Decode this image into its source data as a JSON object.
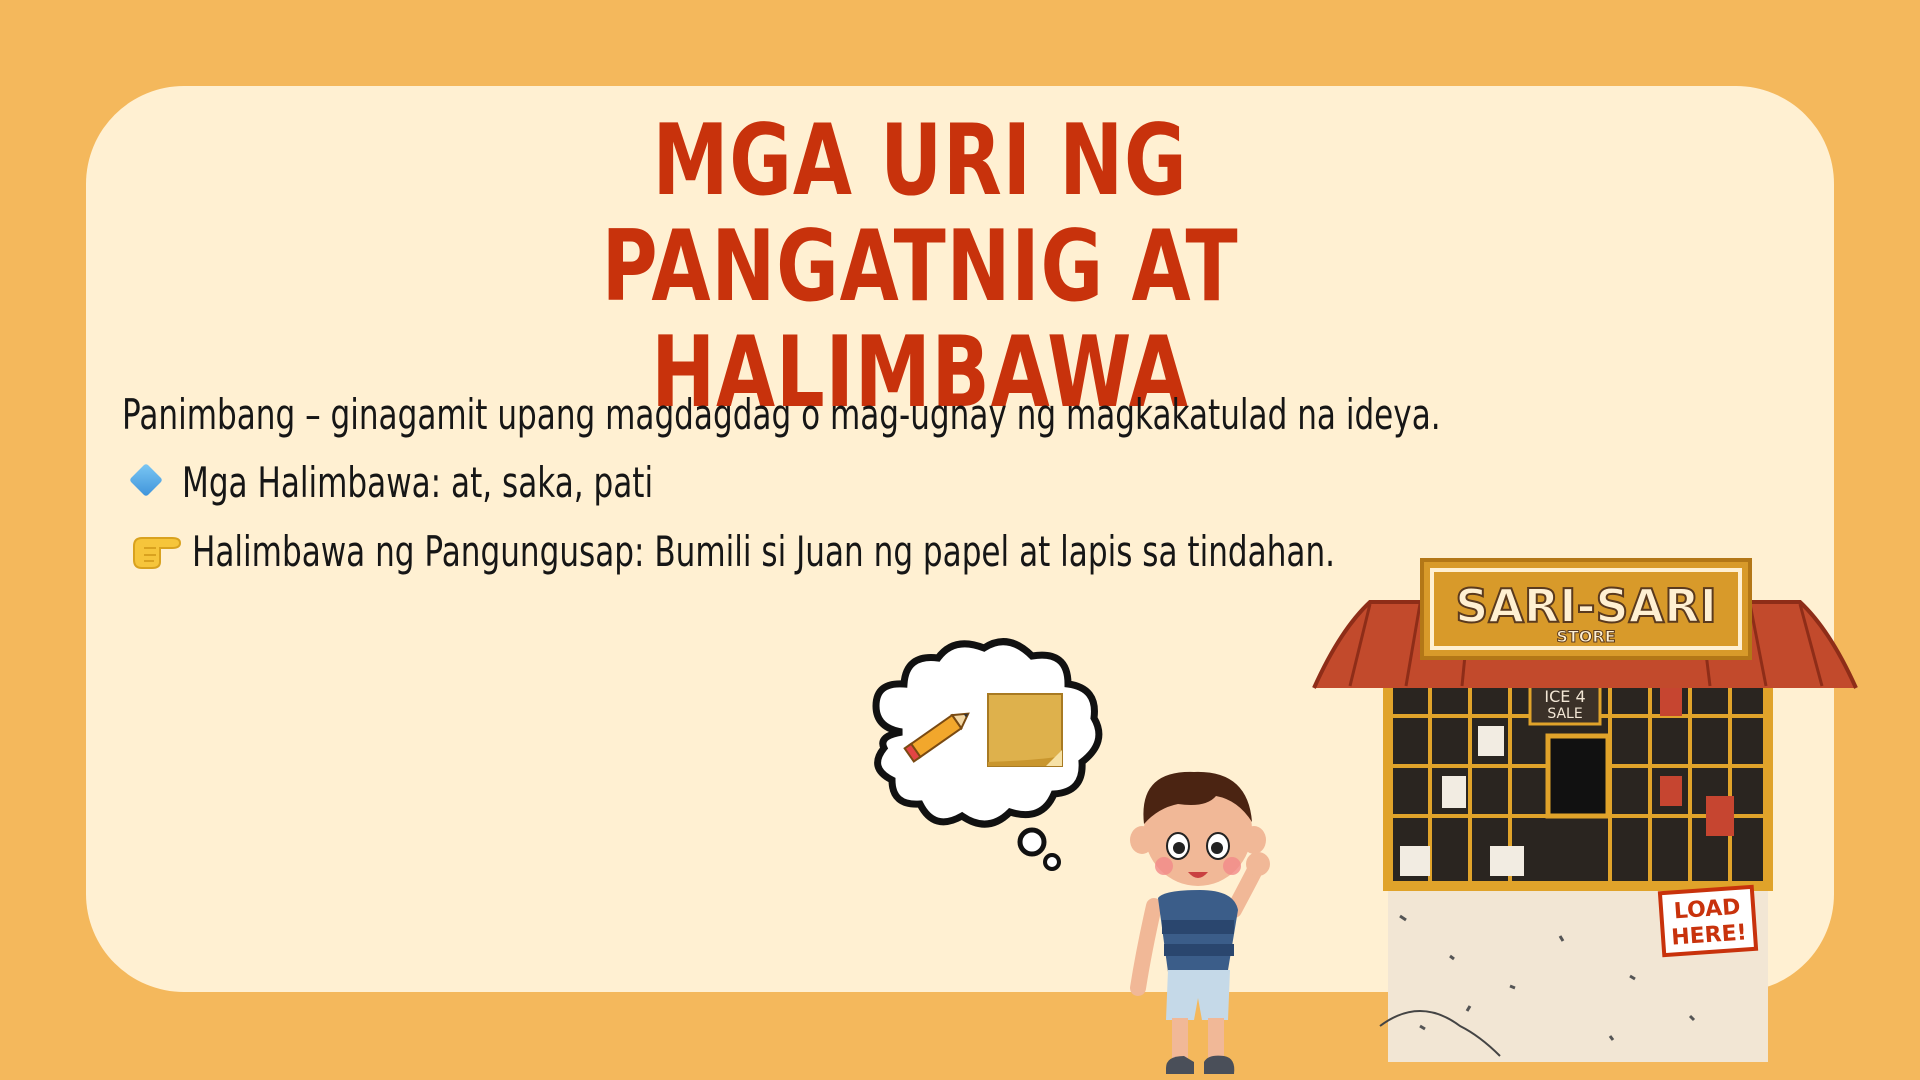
{
  "slide": {
    "title": "MGA URI NG PANGATNIG AT HALIMBAWA",
    "definition": "Panimbang – ginagamit upang magdagdag o mag-ugnay ng magkakatulad na ideya.",
    "examples": "Mga Halimbawa: at, saka, pati",
    "sentence": "Halimbawa ng Pangungusap: Bumili si Juan ng papel at lapis sa tindahan."
  },
  "illustration": {
    "store_sign": "SARI-SARI",
    "store_sign_sub": "STORE",
    "ice_sign": "ICE 4 SALE",
    "load_sign_1": "LOAD",
    "load_sign_2": "HERE!"
  },
  "colors": {
    "background": "#f4b85c",
    "card": "#fff0d2",
    "title": "#c8320c",
    "text": "#161616"
  },
  "icons": [
    "diamond-icon",
    "pointing-hand-icon",
    "pencil-icon",
    "paper-icon"
  ]
}
